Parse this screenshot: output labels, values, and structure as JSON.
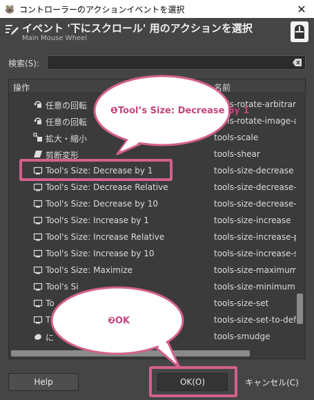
{
  "window": {
    "title": "コントローラーのアクションイベントを選択",
    "close_glyph": "✕"
  },
  "header": {
    "title": "イベント '下にスクロール' 用のアクションを選択",
    "subtitle": "Main Mouse Wheel"
  },
  "search": {
    "label": "検索(S):",
    "value": "",
    "placeholder": ""
  },
  "table": {
    "columns": [
      "操作",
      "名前"
    ],
    "rows": [
      {
        "label": "任意の回転",
        "name": "tools-rotate-arbitrary",
        "icon": "rotate-icon"
      },
      {
        "label": "任意の回転",
        "name": "tools-rotate-image-a",
        "icon": "rotate-icon"
      },
      {
        "label": "拡大・縮小",
        "name": "tools-scale",
        "icon": "scale-icon"
      },
      {
        "label": "剪断変形",
        "name": "tools-shear",
        "icon": "shear-icon"
      },
      {
        "label": "Tool's Size: Decrease by 1",
        "name": "tools-size-decrease",
        "icon": "tool-icon"
      },
      {
        "label": "Tool's Size: Decrease Relative",
        "name": "tools-size-decrease-",
        "icon": "tool-icon"
      },
      {
        "label": "Tool's Size: Decrease by 10",
        "name": "tools-size-decrease-",
        "icon": "tool-icon"
      },
      {
        "label": "Tool's Size: Increase by 1",
        "name": "tools-size-increase",
        "icon": "tool-icon"
      },
      {
        "label": "Tool's Size: Increase Relative",
        "name": "tools-size-increase-p",
        "icon": "tool-icon"
      },
      {
        "label": "Tool's Size: Increase by 10",
        "name": "tools-size-increase-s",
        "icon": "tool-icon"
      },
      {
        "label": "Tool's Size: Maximize",
        "name": "tools-size-maximum",
        "icon": "tool-icon"
      },
      {
        "label": "Tool's Si",
        "name": "tools-size-minimum",
        "icon": "tool-icon"
      },
      {
        "label": "To",
        "name": "tools-size-set",
        "icon": "tool-icon"
      },
      {
        "label": "T",
        "name": "tools-size-set-to-defa",
        "icon": "tool-icon"
      },
      {
        "label": "に",
        "name": "tools-smudge",
        "icon": "smudge-icon"
      }
    ]
  },
  "buttons": {
    "help": "Help",
    "ok": "OK(O)",
    "cancel": "キャンセル(C)"
  },
  "annotations": {
    "callout1": "❶Tool’s Size: Decrease by 1",
    "callout2": "❷OK"
  },
  "colors": {
    "accent": "#d4608d",
    "callout_text": "#c2457a",
    "background": "#454545"
  }
}
